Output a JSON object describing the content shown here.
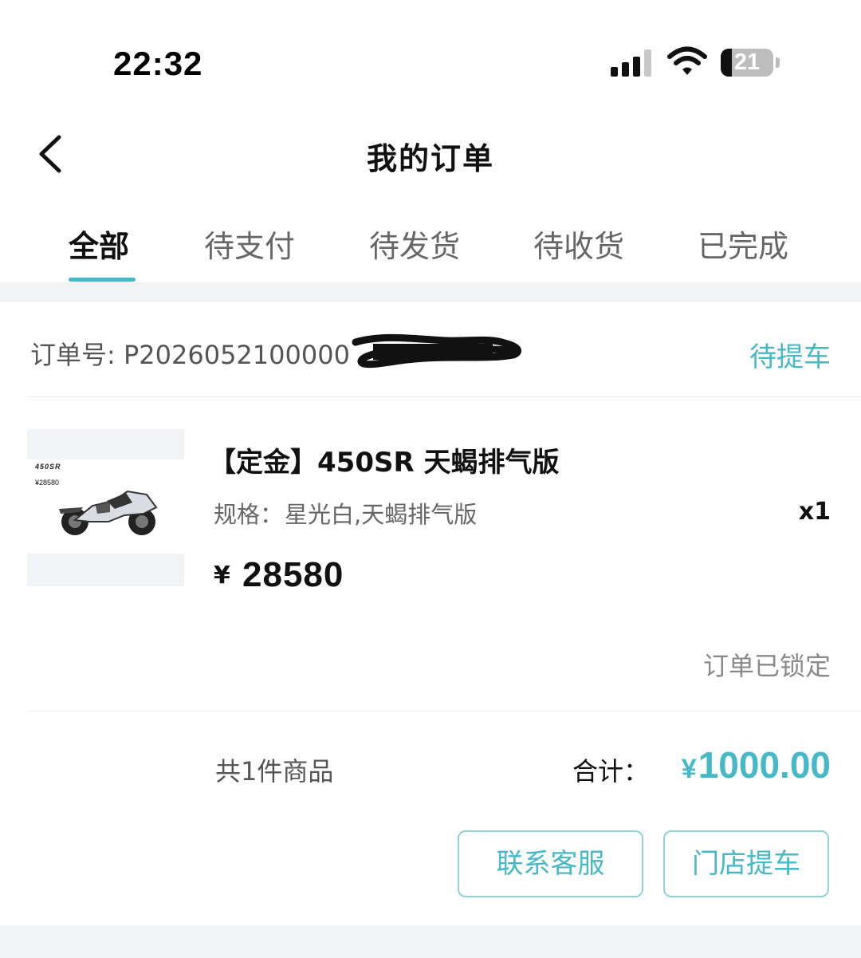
{
  "status_bar": {
    "time": "22:32",
    "battery_level": "21",
    "battery_fraction": 0.21,
    "icons": [
      "cellular-signal-icon",
      "wifi-icon",
      "battery-icon"
    ]
  },
  "header": {
    "back_icon": "chevron-left-icon",
    "title": "我的订单"
  },
  "tabs": [
    {
      "label": "全部",
      "active": true
    },
    {
      "label": "待支付",
      "active": false
    },
    {
      "label": "待发货",
      "active": false
    },
    {
      "label": "待收货",
      "active": false
    },
    {
      "label": "已完成",
      "active": false
    }
  ],
  "order": {
    "number_label": "订单号: ",
    "number_visible": "P2026052100000",
    "status": "待提车",
    "product": {
      "thumbnail": {
        "logo_text": "450SR",
        "price_text": "¥28580"
      },
      "title": "【定金】450SR 天蝎排气版",
      "spec_label": "规格：",
      "spec_value": "星光白,天蝎排气版",
      "quantity": "x1",
      "currency_symbol": "¥",
      "price": "28580"
    },
    "locked_note": "订单已锁定",
    "item_count_text": "共1件商品",
    "total_label": "合计：",
    "total_currency": "¥",
    "total_amount": "1000.00",
    "buttons": {
      "contact_service": "联系客服",
      "store_pickup": "门店提车"
    }
  },
  "colors": {
    "accent": "#45b9c7",
    "button_border": "#8fd2da",
    "band": "#f2f3f5",
    "text_primary": "#111111",
    "text_secondary": "#666666"
  }
}
